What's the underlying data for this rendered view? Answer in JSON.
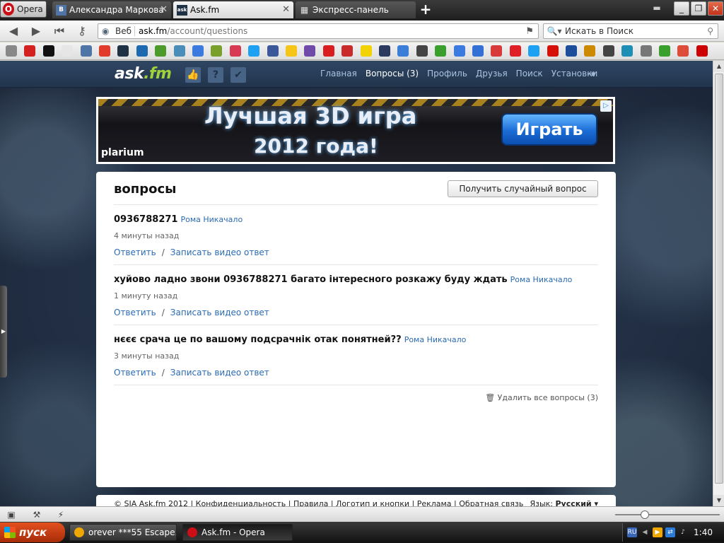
{
  "browser": {
    "menu_label": "Opera",
    "tabs": [
      {
        "label": "Александра Маркова",
        "favicon": "В",
        "favicon_color": "#4f75a7"
      },
      {
        "label": "Ask.fm",
        "favicon": "ask",
        "favicon_color": "#1f3145",
        "active": true
      },
      {
        "label": "Экспресс-панель",
        "favicon": "▦",
        "favicon_color": "#444444"
      }
    ],
    "address": {
      "mode": "Веб",
      "host": "ask.fm",
      "path": "/account/questions"
    },
    "search_placeholder": "Искать в Поиск",
    "bookmark_colors": [
      "#888888",
      "#d52020",
      "#111111",
      "#e6e6e6",
      "#4f75a7",
      "#e03b2b",
      "#1f3145",
      "#1e6ab0",
      "#4c9b2b",
      "#4a8db8",
      "#3b7be0",
      "#79a02a",
      "#d83a53",
      "#1da1f2",
      "#3b5998",
      "#f5c518",
      "#6f4aa8",
      "#d81e1e",
      "#c92a2a",
      "#f2d200",
      "#2b3a5e",
      "#3a7ed8",
      "#444444",
      "#3aa02d",
      "#3b7be0",
      "#3270d6",
      "#d83a3a",
      "#e01f24",
      "#1da1f2",
      "#d51007",
      "#1c4e9b",
      "#cc8a00",
      "#444444",
      "#1d8fb5",
      "#777777",
      "#3aa02d",
      "#dd4b39",
      "#cc0000"
    ]
  },
  "site": {
    "logo_name": "ask",
    "logo_tld": ".fm",
    "nav": [
      {
        "label": "Главная"
      },
      {
        "label": "Вопросы (3)",
        "current": true
      },
      {
        "label": "Профиль"
      },
      {
        "label": "Друзья"
      },
      {
        "label": "Поиск"
      },
      {
        "label": "Установки"
      }
    ],
    "banner": {
      "headline": "Лучшая 3D игра",
      "subline": "2012 года!",
      "brand": "plarium",
      "button": "Играть"
    },
    "page_title": "вопросы",
    "random_button": "Получить случайный вопрос",
    "questions": [
      {
        "text": "0936788271",
        "author": "Рома Никачало",
        "time": "4 минуты назад",
        "reply": "Ответить",
        "video": "Записать видео ответ"
      },
      {
        "text": "хуйово ладно звони 0936788271 багато інтересного розкажу буду ждать",
        "author": "Рома Никачало",
        "time": "1 минуту назад",
        "reply": "Ответить",
        "video": "Записать видео ответ"
      },
      {
        "text": "нєєє срача це по вашому подсрачнік отак понятней??",
        "author": "Рома Никачало",
        "time": "3 минуты назад",
        "reply": "Ответить",
        "video": "Записать видео ответ"
      }
    ],
    "delete_all": "Удалить все вопросы (3)",
    "footer": {
      "text": "© SIA Ask.fm 2012 | Конфиденциальность | Правила | Логотип и кнопки | Реклама | Обратная связь",
      "lang_label": "Язык:",
      "lang_value": "Русский ▾"
    }
  },
  "taskbar": {
    "start": "пуск",
    "tasks": [
      {
        "label": "orever ***55 Escape...",
        "icon_color": "#f0a800"
      },
      {
        "label": "Ask.fm - Opera",
        "icon_color": "#cc0f16",
        "active": true
      }
    ],
    "tray_lang": "RU",
    "clock": "1:40"
  }
}
